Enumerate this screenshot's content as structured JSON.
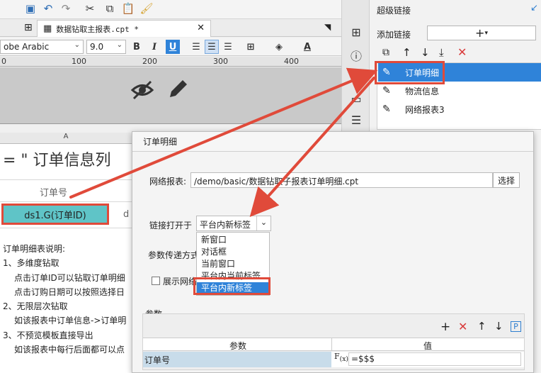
{
  "editor": {
    "tab_title": "数据钻取主报表.cpt *",
    "font_name": "obe Arabic",
    "font_size": "9.0",
    "ruler_marks": [
      "0",
      "100",
      "200",
      "300",
      "400"
    ],
    "column_letter": "A",
    "cells": {
      "title": "= \"  订单信息列",
      "order_no": "订单号",
      "ds_cell": "ds1.G(订单ID)",
      "partial_d": "d"
    },
    "notes": [
      "订单明细表说明:",
      "1、多维度钻取",
      "点击订单ID可以钻取订单明细",
      "点击订购日期可以按照选择日",
      "2、无限层次钻取",
      "如该报表中订单信息->订单明",
      "3、不预览模板直接导出",
      "如该报表中每行后面都可以点"
    ]
  },
  "hyperlink_panel": {
    "title": "超级链接",
    "add_label": "添加链接",
    "items": [
      {
        "label": "订单明细",
        "selected": true
      },
      {
        "label": "物流信息",
        "selected": false
      },
      {
        "label": "网络报表3",
        "selected": false
      }
    ]
  },
  "dialog": {
    "title": "订单明细",
    "report_label": "网络报表:",
    "report_path": "/demo/basic/数据钻取子报表订单明细.cpt",
    "choose_button": "选择",
    "open_in_label": "链接打开于",
    "open_in_value": "平台内新标签",
    "open_in_options": [
      "新窗口",
      "对话框",
      "当前窗口",
      "平台内当前标签",
      "平台内新标签"
    ],
    "param_pass_label": "参数传递方式",
    "show_network_label": "展示网络",
    "params_section": "参数",
    "params_columns": [
      "参数",
      "值"
    ],
    "params_rows": [
      {
        "name": "订单号",
        "value": "=$$$"
      }
    ]
  },
  "colors": {
    "accent": "#2f7fd0",
    "selection_bg": "#2f83d9",
    "highlight_red": "#e04a3a",
    "cell_teal": "#5fc4c7"
  }
}
